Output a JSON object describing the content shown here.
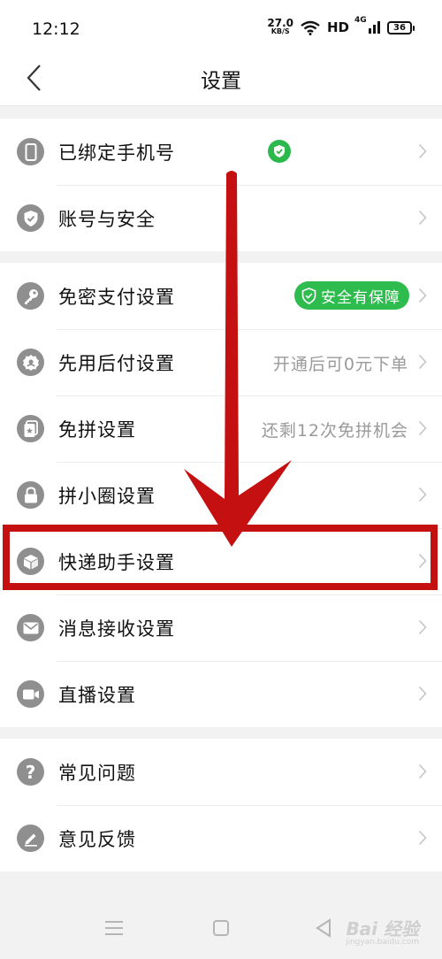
{
  "status_bar": {
    "time": "12:12",
    "net_speed_value": "27.0",
    "net_speed_unit": "KB/S",
    "hd": "HD",
    "signal": "4G",
    "battery": "36"
  },
  "header": {
    "title": "设置"
  },
  "groups": [
    {
      "items": [
        {
          "label": "已绑定手机号",
          "icon": "phone-icon",
          "badge": "verified"
        },
        {
          "label": "账号与安全",
          "icon": "shield-icon"
        }
      ]
    },
    {
      "items": [
        {
          "label": "免密支付设置",
          "icon": "key-icon",
          "badge_text": "安全有保障"
        },
        {
          "label": "先用后付设置",
          "icon": "badge-gear-icon",
          "value": "开通后可0元下单"
        },
        {
          "label": "免拼设置",
          "icon": "ticket-icon",
          "value": "还剩12次免拼机会"
        },
        {
          "label": "拼小圈设置",
          "icon": "lock-icon"
        },
        {
          "label": "快递助手设置",
          "icon": "package-icon"
        },
        {
          "label": "消息接收设置",
          "icon": "mail-icon"
        },
        {
          "label": "直播设置",
          "icon": "video-camera-icon"
        }
      ]
    },
    {
      "items": [
        {
          "label": "常见问题",
          "icon": "question-icon"
        },
        {
          "label": "意见反馈",
          "icon": "pencil-icon"
        }
      ]
    }
  ],
  "annotation": {
    "highlight_color": "#c41010",
    "highlighted_item": "快递助手设置"
  },
  "watermark": {
    "text": "Bai 经验",
    "sub": "jingyan.baidu.com"
  },
  "colors": {
    "accent_green": "#2ebc4f",
    "icon_gray": "#8f8f8f",
    "value_gray": "#9a9a9a"
  }
}
